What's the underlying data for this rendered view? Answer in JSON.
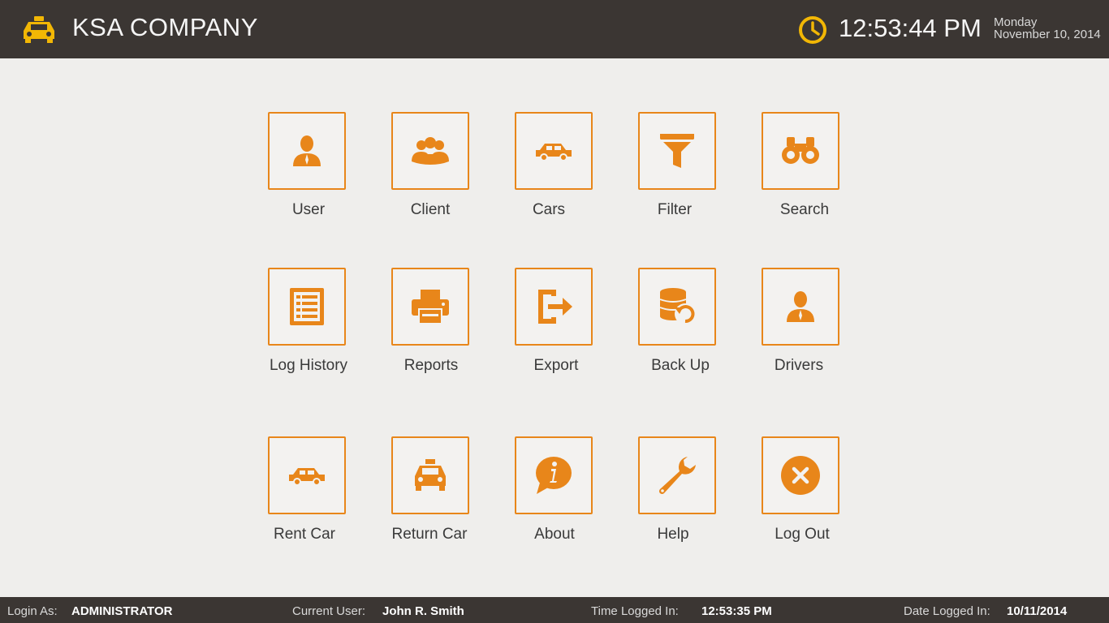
{
  "header": {
    "title": "KSA COMPANY",
    "time": "12:53:44 PM",
    "day": "Monday",
    "date": "November 10, 2014",
    "logo_icon": "taxi-icon",
    "clock_icon": "clock-icon"
  },
  "colors": {
    "accent": "#e8861a",
    "bar": "#3b3633",
    "logo": "#f2b705",
    "background": "#efeeec"
  },
  "menu": [
    {
      "label": "User",
      "icon": "user-icon"
    },
    {
      "label": "Client",
      "icon": "group-icon"
    },
    {
      "label": "Cars",
      "icon": "car-icon"
    },
    {
      "label": "Filter",
      "icon": "filter-icon"
    },
    {
      "label": "Search",
      "icon": "binoculars-icon"
    },
    {
      "label": "Log History",
      "icon": "list-icon"
    },
    {
      "label": "Reports",
      "icon": "printer-icon"
    },
    {
      "label": "Export",
      "icon": "export-icon"
    },
    {
      "label": "Back Up",
      "icon": "database-restore-icon"
    },
    {
      "label": "Drivers",
      "icon": "driver-icon"
    },
    {
      "label": "Rent Car",
      "icon": "car-icon"
    },
    {
      "label": "Return Car",
      "icon": "taxi-icon"
    },
    {
      "label": "About",
      "icon": "info-bubble-icon"
    },
    {
      "label": "Help",
      "icon": "wrench-icon"
    },
    {
      "label": "Log Out",
      "icon": "close-circle-icon"
    }
  ],
  "footer": {
    "login_as_label": "Login As:",
    "login_as_value": "ADMINISTRATOR",
    "current_user_label": "Current User:",
    "current_user_value": "John R. Smith",
    "time_logged_label": "Time Logged In:",
    "time_logged_value": "12:53:35 PM",
    "date_logged_label": "Date Logged In:",
    "date_logged_value": "10/11/2014"
  }
}
